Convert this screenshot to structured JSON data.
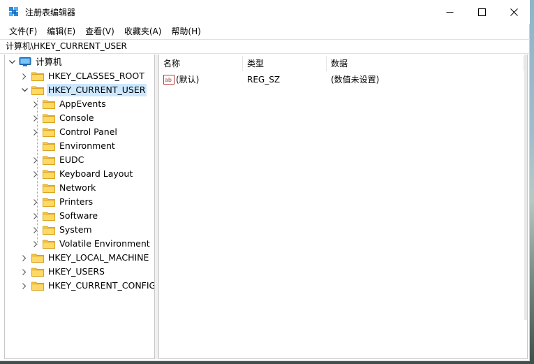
{
  "window": {
    "title": "注册表编辑器",
    "controls": {
      "minimize": "minimize-icon",
      "maximize": "maximize-icon",
      "close": "close-icon"
    }
  },
  "menu": [
    "文件(F)",
    "编辑(E)",
    "查看(V)",
    "收藏夹(A)",
    "帮助(H)"
  ],
  "address": "计算机\\HKEY_CURRENT_USER",
  "tree": {
    "root": "计算机",
    "hives": [
      {
        "label": "HKEY_CLASSES_ROOT",
        "expanded": false
      },
      {
        "label": "HKEY_CURRENT_USER",
        "expanded": true,
        "selected": true
      },
      {
        "label": "HKEY_LOCAL_MACHINE",
        "expanded": false
      },
      {
        "label": "HKEY_USERS",
        "expanded": false
      },
      {
        "label": "HKEY_CURRENT_CONFIG",
        "expanded": false
      }
    ],
    "children": [
      {
        "label": "AppEvents",
        "has_children": true
      },
      {
        "label": "Console",
        "has_children": true
      },
      {
        "label": "Control Panel",
        "has_children": true
      },
      {
        "label": "Environment",
        "has_children": false
      },
      {
        "label": "EUDC",
        "has_children": true
      },
      {
        "label": "Keyboard Layout",
        "has_children": true
      },
      {
        "label": "Network",
        "has_children": false
      },
      {
        "label": "Printers",
        "has_children": true
      },
      {
        "label": "Software",
        "has_children": true
      },
      {
        "label": "System",
        "has_children": true
      },
      {
        "label": "Volatile Environment",
        "has_children": true
      }
    ]
  },
  "list": {
    "columns": [
      "名称",
      "类型",
      "数据"
    ],
    "rows": [
      {
        "name": "(默认)",
        "type": "REG_SZ",
        "data": "(数值未设置)",
        "icon": "string-value-icon"
      }
    ]
  },
  "colors": {
    "selection": "#cce8ff",
    "folder": "#f4c64f",
    "computer": "#2f8ad8"
  }
}
